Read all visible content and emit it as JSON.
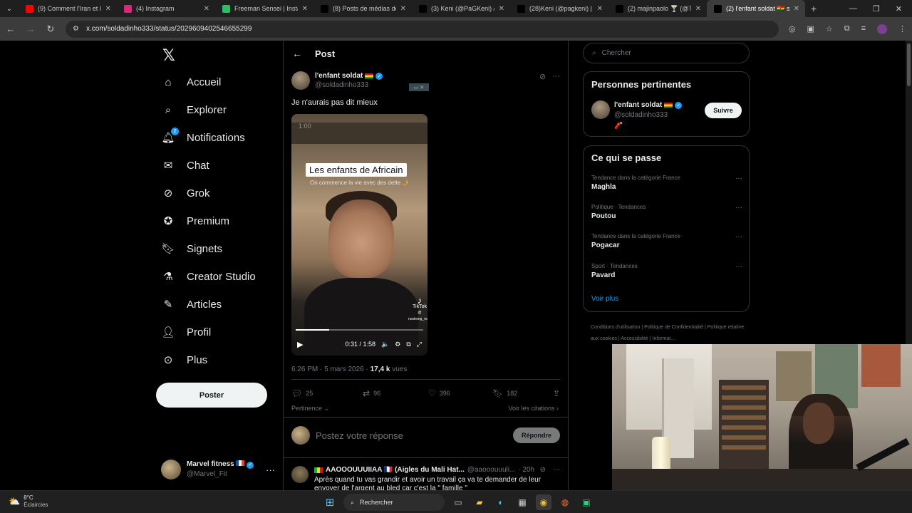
{
  "browser": {
    "tabs": [
      {
        "title": "(9) Comment l'Iran et les",
        "icon_color": "#ff0000",
        "icon": "youtube-icon"
      },
      {
        "title": "(4) Instagram",
        "icon_color": "#d62976",
        "icon": "instagram-icon"
      },
      {
        "title": "Freeman Sensei | Instagra",
        "icon_color": "#2bbf6a",
        "icon": "freeman-icon"
      },
      {
        "title": "(8) Posts de médias de BI",
        "icon_color": "#000000",
        "icon": "x-icon"
      },
      {
        "title": "(3) Keni (@PaGKeni) / X",
        "icon_color": "#000000",
        "icon": "x-icon"
      },
      {
        "title": "(28)Keni (@pagkeni) | Tik",
        "icon_color": "#000000",
        "icon": "tiktok-icon"
      },
      {
        "title": "(2) majinpaolo 🍸 (@7pa",
        "icon_color": "#000000",
        "icon": "x-icon"
      },
      {
        "title": "(2) l'enfant soldat 🇬🇭 sur X",
        "icon_color": "#000000",
        "icon": "x-icon"
      }
    ],
    "url": "x.com/soldadinho333/status/2029609402546655299"
  },
  "nav": {
    "logo": "𝕏",
    "items": [
      {
        "label": "Accueil",
        "icon": "home-icon"
      },
      {
        "label": "Explorer",
        "icon": "search-icon"
      },
      {
        "label": "Notifications",
        "icon": "bell-icon",
        "badge": "2"
      },
      {
        "label": "Chat",
        "icon": "mail-icon"
      },
      {
        "label": "Grok",
        "icon": "grok-icon"
      },
      {
        "label": "Premium",
        "icon": "premium-icon"
      },
      {
        "label": "Signets",
        "icon": "bookmark-icon"
      },
      {
        "label": "Creator Studio",
        "icon": "flask-icon"
      },
      {
        "label": "Articles",
        "icon": "article-icon"
      },
      {
        "label": "Profil",
        "icon": "person-icon"
      },
      {
        "label": "Plus",
        "icon": "more-circle-icon"
      }
    ],
    "post_button": "Poster",
    "account": {
      "name": "Marvel fitness",
      "handle": "@Marvel_Fit"
    }
  },
  "post": {
    "header_title": "Post",
    "author_name": "l'enfant soldat",
    "author_handle": "@soldadinho333",
    "text": "Je n'aurais pas dit mieux",
    "video": {
      "time_chip": "1:00",
      "caption": "Les enfants de Africain",
      "subcaption": "On commence la vie avec des dette 🤳",
      "tiktok_label": "TikTok",
      "tiktok_user": "@ nostrong_man",
      "time": "0:31 / 1:58",
      "progress": 0.26
    },
    "meta_time": "6:26 PM · 5 mars 2026 · ",
    "meta_views": "17,4 k",
    "meta_views_label": " vues",
    "actions": {
      "replies": "25",
      "reposts": "96",
      "likes": "396",
      "bookmarks": "182"
    },
    "pertinence": "Pertinence",
    "citations": "Voir les citations",
    "reply_placeholder": "Postez votre réponse",
    "reply_button": "Répondre"
  },
  "reply": {
    "name": "AAOOOUUUIIAA 🇫🇷 (Aigles du Mali Hat...",
    "handle": "@aaooouuuli...",
    "time": "· 20h",
    "text": "Après quand tu vas grandir et avoir un travail ça va te demander de leur envoyer de l'argent au bled car c'est la \" famille \""
  },
  "right": {
    "search_placeholder": "Chercher",
    "relevant_title": "Personnes pertinentes",
    "relevant_person": {
      "name": "l'enfant soldat",
      "handle": "@soldadinho333",
      "bio": "🧨",
      "button": "Suivre"
    },
    "trends_title": "Ce qui se passe",
    "trends": [
      {
        "category": "Tendance dans la catégorie France",
        "name": "Maghla"
      },
      {
        "category": "Politique · Tendances",
        "name": "Poutou"
      },
      {
        "category": "Tendance dans la catégorie France",
        "name": "Pogacar"
      },
      {
        "category": "Sport · Tendances",
        "name": "Pavard"
      }
    ],
    "see_more": "Voir plus",
    "footer": [
      "Conditions d'utilisation",
      "Politique de Confidentialité",
      "Politique relative aux cookies",
      "Accessibilité",
      "Informat..."
    ]
  },
  "taskbar": {
    "temp": "8°C",
    "weather": "Éclaircies",
    "search": "Rechercher"
  },
  "colors": {
    "accent": "#1d9bf0",
    "background": "#000000",
    "border": "#2f3336"
  }
}
